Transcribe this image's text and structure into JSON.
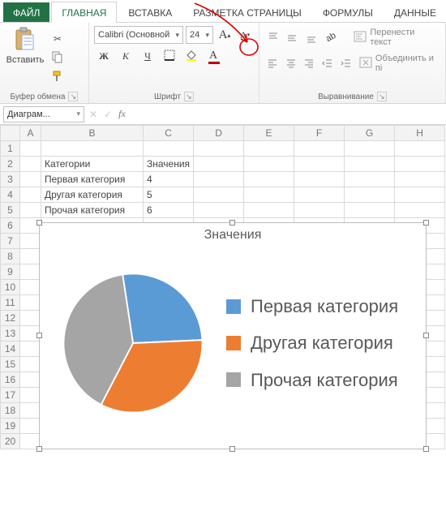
{
  "tabs": {
    "file": "ФАЙЛ",
    "home": "ГЛАВНАЯ",
    "insert": "ВСТАВКА",
    "pagelayout": "РАЗМЕТКА СТРАНИЦЫ",
    "formulas": "ФОРМУЛЫ",
    "data": "ДАННЫЕ"
  },
  "ribbon": {
    "clipboard": {
      "paste": "Вставить",
      "label": "Буфер обмена"
    },
    "font": {
      "name": "Calibri (Основной",
      "size": "24",
      "label": "Шрифт",
      "bold": "Ж",
      "italic": "К",
      "underline": "Ч"
    },
    "align": {
      "label": "Выравнивание",
      "wrap": "Перенести текст",
      "merge": "Объединить и пі"
    }
  },
  "namebox": "Диаграм...",
  "sheetdata": {
    "headers": [
      "A",
      "B",
      "C",
      "D",
      "E",
      "F",
      "G",
      "H"
    ],
    "rows": [
      {
        "r": 1,
        "b": "",
        "c": ""
      },
      {
        "r": 2,
        "b": "Категории",
        "c": "Значения"
      },
      {
        "r": 3,
        "b": "Первая категория",
        "c": "4"
      },
      {
        "r": 4,
        "b": "Другая категория",
        "c": "5"
      },
      {
        "r": 5,
        "b": "Прочая категория",
        "c": "6"
      }
    ],
    "emptyrows": [
      6,
      7,
      8,
      9,
      10,
      11,
      12,
      13,
      14,
      15,
      16,
      17,
      18,
      19,
      20
    ]
  },
  "chart_data": {
    "type": "pie",
    "title": "Значения",
    "categories": [
      "Первая категория",
      "Другая категория",
      "Прочая категория"
    ],
    "values": [
      4,
      5,
      6
    ],
    "colors": [
      "#5B9BD5",
      "#ED7D31",
      "#A5A5A5"
    ],
    "series_name": "Значения",
    "legend_position": "right"
  }
}
